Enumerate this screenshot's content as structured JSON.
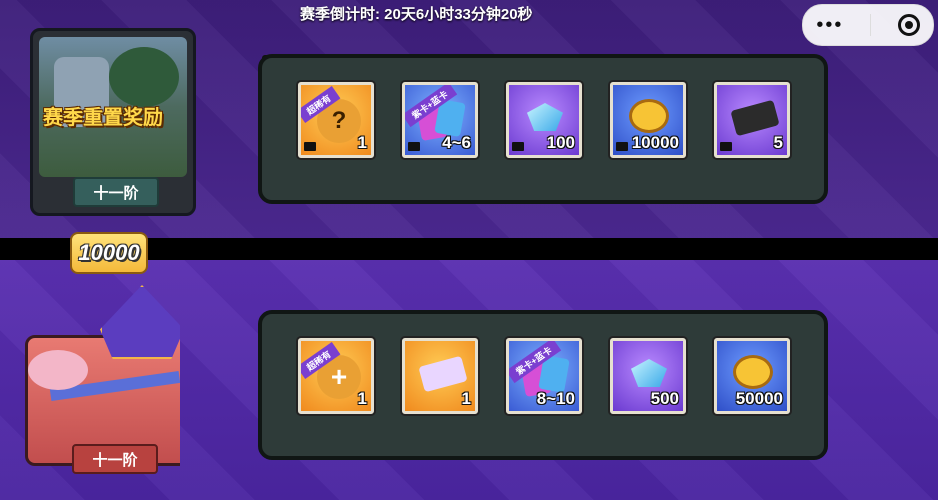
{
  "header": {
    "countdown": "赛季倒计时: 20天6小时33分钟20秒"
  },
  "capsule": {
    "more_glyph": "•••"
  },
  "tiers": [
    {
      "title": "赛季重置奖励",
      "level": "十一阶",
      "rewards": [
        {
          "qty": "1",
          "icon": "mystery-box-icon",
          "ribbon": "超稀有"
        },
        {
          "qty": "4~6",
          "icon": "card-pack-icon",
          "ribbon": "紫卡+蓝卡"
        },
        {
          "qty": "100",
          "icon": "gem-icon",
          "ribbon": ""
        },
        {
          "qty": "10000",
          "icon": "coin-icon",
          "ribbon": ""
        },
        {
          "qty": "5",
          "icon": "ticket-icon",
          "ribbon": ""
        }
      ]
    },
    {
      "title": "",
      "level": "十一阶",
      "requirement": "10000",
      "rewards": [
        {
          "qty": "1",
          "icon": "plus-box-icon",
          "ribbon": "超稀有"
        },
        {
          "qty": "1",
          "icon": "ticket-icon",
          "ribbon": ""
        },
        {
          "qty": "8~10",
          "icon": "card-pack-icon",
          "ribbon": "紫卡+蓝卡"
        },
        {
          "qty": "500",
          "icon": "gem-icon",
          "ribbon": ""
        },
        {
          "qty": "50000",
          "icon": "coin-icon",
          "ribbon": ""
        }
      ]
    }
  ]
}
